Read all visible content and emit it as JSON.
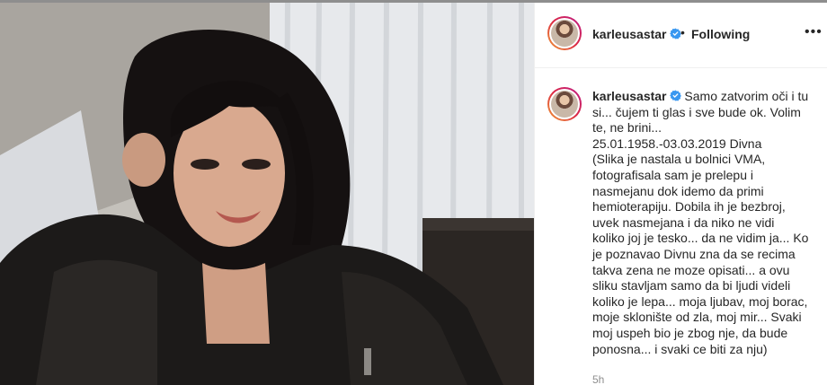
{
  "post": {
    "username": "karleusastar",
    "follow_separator": "•",
    "follow_status": "Following",
    "more_icon": "•••"
  },
  "caption": {
    "username": "karleusastar",
    "lines": [
      "Samo zatvorim oči i tu",
      "si... čujem ti glas i sve bude ok. Volim",
      "te, ne brini...",
      "25.01.1958.-03.03.2019 Divna",
      "(Slika je nastala u bolnici VMA,",
      "fotografisala sam je prelepu i",
      "nasmejanu dok idemo da primi",
      "hemioterapiju. Dobila ih je bezbroj,",
      "uvek nasmejana i da niko ne vidi",
      "koliko joj je tesko... da ne vidim ja... Ko",
      "je poznavao Divnu zna da se recima",
      "takva zena ne moze opisati... a ovu",
      "sliku stavljam samo da bi ljudi videli",
      "koliko je lepa... moja ljubav, moj borac,",
      "moje sklonište od zla, moj mir... Svaki",
      "moj uspeh bio je zbog nje, da bude",
      "ponosna... i svaki ce biti za nju)"
    ]
  },
  "time_ago": "5h",
  "colors": {
    "verified": "#3897f0",
    "text": "#262626",
    "muted": "#8e8e8e"
  }
}
